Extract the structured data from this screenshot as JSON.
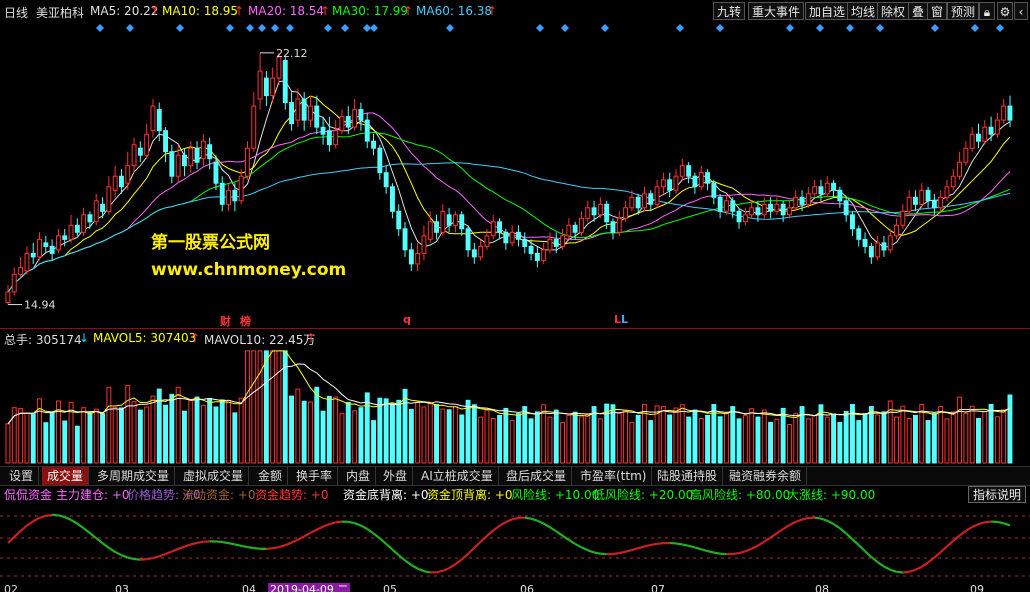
{
  "header": {
    "period": "日线",
    "stock_name": "美亚柏科",
    "ma5": {
      "label": "MA5: 20.22",
      "color": "#e0e0e0",
      "arrow": "up"
    },
    "ma10": {
      "label": "MA10: 18.95",
      "color": "#ffff00",
      "arrow": "up"
    },
    "ma20": {
      "label": "MA20: 18.54",
      "color": "#ff66ff",
      "arrow": "up"
    },
    "ma30": {
      "label": "MA30: 17.99",
      "color": "#00ff00",
      "arrow": "up"
    },
    "ma60": {
      "label": "MA60: 16.38",
      "color": "#44ccff",
      "arrow": "up"
    }
  },
  "toolbar": [
    "九转",
    "重大事件",
    "加自选",
    "均线",
    "除权",
    "叠",
    "窗",
    "预测"
  ],
  "price_chart": {
    "high_label": "22.12",
    "low_label": "14.94",
    "candles": [
      [
        15.0,
        15.3,
        14.94,
        15.5
      ],
      [
        15.3,
        15.8,
        15.2,
        16.0
      ],
      [
        15.8,
        16.0,
        15.7,
        16.3
      ],
      [
        15.9,
        16.4,
        15.8,
        16.6
      ],
      [
        16.4,
        16.3,
        16.1,
        16.7
      ],
      [
        16.3,
        16.8,
        16.2,
        17.0
      ],
      [
        16.7,
        16.6,
        16.4,
        16.9
      ],
      [
        16.6,
        16.4,
        16.2,
        16.8
      ],
      [
        16.5,
        16.9,
        16.4,
        17.1
      ],
      [
        16.9,
        16.8,
        16.6,
        17.1
      ],
      [
        16.8,
        17.2,
        16.7,
        17.5
      ],
      [
        17.2,
        17.0,
        16.9,
        17.4
      ],
      [
        17.0,
        17.5,
        16.9,
        17.7
      ],
      [
        17.5,
        17.3,
        17.1,
        17.6
      ],
      [
        17.3,
        17.9,
        17.2,
        18.1
      ],
      [
        17.8,
        17.6,
        17.4,
        18.0
      ],
      [
        17.6,
        18.3,
        17.5,
        18.6
      ],
      [
        18.2,
        18.6,
        18.0,
        18.9
      ],
      [
        18.6,
        18.3,
        18.1,
        18.8
      ],
      [
        18.4,
        18.9,
        18.2,
        19.3
      ],
      [
        18.9,
        19.5,
        18.7,
        19.7
      ],
      [
        19.4,
        19.2,
        19.0,
        19.6
      ],
      [
        19.2,
        19.8,
        19.1,
        20.1
      ],
      [
        19.9,
        20.6,
        19.7,
        20.8
      ],
      [
        20.5,
        19.9,
        19.6,
        20.7
      ],
      [
        19.9,
        19.3,
        19.0,
        20.0
      ],
      [
        19.3,
        18.6,
        18.4,
        19.5
      ],
      [
        18.6,
        19.2,
        18.4,
        19.5
      ],
      [
        19.2,
        18.9,
        18.6,
        19.4
      ],
      [
        18.9,
        19.4,
        18.7,
        19.6
      ],
      [
        19.4,
        19.0,
        18.8,
        19.6
      ],
      [
        19.1,
        19.6,
        18.9,
        19.8
      ],
      [
        19.5,
        19.1,
        18.8,
        19.7
      ],
      [
        19.0,
        18.4,
        18.2,
        19.2
      ],
      [
        18.4,
        17.8,
        17.6,
        18.6
      ],
      [
        17.8,
        18.2,
        17.6,
        18.4
      ],
      [
        18.2,
        17.9,
        17.6,
        18.4
      ],
      [
        17.9,
        18.6,
        17.8,
        18.8
      ],
      [
        18.6,
        19.4,
        18.5,
        19.6
      ],
      [
        19.4,
        20.6,
        19.3,
        21.0
      ],
      [
        20.8,
        21.6,
        20.5,
        22.12
      ],
      [
        21.4,
        20.9,
        20.6,
        21.6
      ],
      [
        20.9,
        21.4,
        20.7,
        21.7
      ],
      [
        21.4,
        22.0,
        21.2,
        22.12
      ],
      [
        21.9,
        20.7,
        20.5,
        22.0
      ],
      [
        20.7,
        20.1,
        19.9,
        21.0
      ],
      [
        20.2,
        20.8,
        20.0,
        21.1
      ],
      [
        20.8,
        20.2,
        19.9,
        21.0
      ],
      [
        20.2,
        20.6,
        20.0,
        20.9
      ],
      [
        20.6,
        20.0,
        19.8,
        20.9
      ],
      [
        20.0,
        19.8,
        19.5,
        20.3
      ],
      [
        19.9,
        19.5,
        19.3,
        20.3
      ],
      [
        19.5,
        19.9,
        19.4,
        20.2
      ],
      [
        19.9,
        20.3,
        19.8,
        20.5
      ],
      [
        20.3,
        20.0,
        19.8,
        20.6
      ],
      [
        20.0,
        20.5,
        19.9,
        20.8
      ],
      [
        20.5,
        20.2,
        19.9,
        20.7
      ],
      [
        20.2,
        19.6,
        19.4,
        20.4
      ],
      [
        19.6,
        19.4,
        19.2,
        19.8
      ],
      [
        19.4,
        18.7,
        18.5,
        19.5
      ],
      [
        18.7,
        18.3,
        18.1,
        18.9
      ],
      [
        18.3,
        17.6,
        17.4,
        18.4
      ],
      [
        17.6,
        17.1,
        16.9,
        17.8
      ],
      [
        17.1,
        16.5,
        16.3,
        17.3
      ],
      [
        16.5,
        16.1,
        15.9,
        16.7
      ],
      [
        16.1,
        16.4,
        15.9,
        16.7
      ],
      [
        16.4,
        16.9,
        16.2,
        17.2
      ],
      [
        16.8,
        17.3,
        16.7,
        17.6
      ],
      [
        17.3,
        17.0,
        16.8,
        17.5
      ],
      [
        17.0,
        17.6,
        16.9,
        17.8
      ],
      [
        17.5,
        17.2,
        17.0,
        17.7
      ],
      [
        17.2,
        17.5,
        17.0,
        17.6
      ],
      [
        17.5,
        17.1,
        16.9,
        17.6
      ],
      [
        17.1,
        16.5,
        16.3,
        17.2
      ],
      [
        16.5,
        16.3,
        16.1,
        16.7
      ],
      [
        16.3,
        16.6,
        16.2,
        16.8
      ],
      [
        16.6,
        16.9,
        16.5,
        17.1
      ],
      [
        16.9,
        17.3,
        16.8,
        17.5
      ],
      [
        17.3,
        17.0,
        16.8,
        17.4
      ],
      [
        17.0,
        16.7,
        16.5,
        17.1
      ],
      [
        16.7,
        17.0,
        16.6,
        17.2
      ],
      [
        17.0,
        16.8,
        16.6,
        17.2
      ],
      [
        16.8,
        16.6,
        16.4,
        17.0
      ],
      [
        16.6,
        16.4,
        16.2,
        16.8
      ],
      [
        16.4,
        16.2,
        16.0,
        16.6
      ],
      [
        16.2,
        16.5,
        16.1,
        16.7
      ],
      [
        16.5,
        16.8,
        16.4,
        17.0
      ],
      [
        16.8,
        16.6,
        16.4,
        17.0
      ],
      [
        16.6,
        16.9,
        16.5,
        17.1
      ],
      [
        16.9,
        17.2,
        16.8,
        17.4
      ],
      [
        17.2,
        17.0,
        16.8,
        17.3
      ],
      [
        17.0,
        17.4,
        16.9,
        17.6
      ],
      [
        17.4,
        17.7,
        17.3,
        17.9
      ],
      [
        17.7,
        17.5,
        17.3,
        17.9
      ],
      [
        17.5,
        17.8,
        17.4,
        18.0
      ],
      [
        17.8,
        17.3,
        17.1,
        17.9
      ],
      [
        17.3,
        17.0,
        16.8,
        17.4
      ],
      [
        17.0,
        17.4,
        16.9,
        17.6
      ],
      [
        17.4,
        17.7,
        17.3,
        17.9
      ],
      [
        17.7,
        18.0,
        17.6,
        18.2
      ],
      [
        18.0,
        17.7,
        17.5,
        18.1
      ],
      [
        17.7,
        18.1,
        17.6,
        18.3
      ],
      [
        18.1,
        17.8,
        17.6,
        18.2
      ],
      [
        17.8,
        18.3,
        17.7,
        18.5
      ],
      [
        18.3,
        18.5,
        18.1,
        18.7
      ],
      [
        18.5,
        18.2,
        18.0,
        18.7
      ],
      [
        18.2,
        18.6,
        18.1,
        18.8
      ],
      [
        18.6,
        18.9,
        18.5,
        19.1
      ],
      [
        18.9,
        18.6,
        18.4,
        19.0
      ],
      [
        18.6,
        18.3,
        18.1,
        18.7
      ],
      [
        18.3,
        18.7,
        18.2,
        18.9
      ],
      [
        18.7,
        18.4,
        18.2,
        18.8
      ],
      [
        18.4,
        18.0,
        17.8,
        18.5
      ],
      [
        18.0,
        17.6,
        17.4,
        18.1
      ],
      [
        17.6,
        17.9,
        17.5,
        18.1
      ],
      [
        17.9,
        17.6,
        17.4,
        18.0
      ],
      [
        17.6,
        17.3,
        17.1,
        17.7
      ],
      [
        17.3,
        17.5,
        17.2,
        17.7
      ],
      [
        17.5,
        17.7,
        17.4,
        17.9
      ],
      [
        17.7,
        17.5,
        17.3,
        17.9
      ],
      [
        17.5,
        17.8,
        17.4,
        18.0
      ],
      [
        17.8,
        17.6,
        17.4,
        18.0
      ],
      [
        17.6,
        17.8,
        17.5,
        18.0
      ],
      [
        17.8,
        17.5,
        17.3,
        17.9
      ],
      [
        17.5,
        17.7,
        17.4,
        17.9
      ],
      [
        17.7,
        18.0,
        17.6,
        18.2
      ],
      [
        18.0,
        17.8,
        17.6,
        18.2
      ],
      [
        17.8,
        18.1,
        17.7,
        18.3
      ],
      [
        18.1,
        18.3,
        18.0,
        18.5
      ],
      [
        18.3,
        18.1,
        17.9,
        18.5
      ],
      [
        18.1,
        18.4,
        18.0,
        18.6
      ],
      [
        18.4,
        18.2,
        18.0,
        18.5
      ],
      [
        18.2,
        17.9,
        17.7,
        18.3
      ],
      [
        17.9,
        17.5,
        17.3,
        18.0
      ],
      [
        17.5,
        17.1,
        16.9,
        17.6
      ],
      [
        17.1,
        16.8,
        16.6,
        17.2
      ],
      [
        16.8,
        16.6,
        16.4,
        17.0
      ],
      [
        16.6,
        16.3,
        16.1,
        16.7
      ],
      [
        16.3,
        16.7,
        16.2,
        16.9
      ],
      [
        16.7,
        16.5,
        16.3,
        16.9
      ],
      [
        16.5,
        16.9,
        16.4,
        17.1
      ],
      [
        16.9,
        17.2,
        16.8,
        17.4
      ],
      [
        17.2,
        17.6,
        17.1,
        17.8
      ],
      [
        17.6,
        18.0,
        17.5,
        18.2
      ],
      [
        18.0,
        17.8,
        17.6,
        18.2
      ],
      [
        17.8,
        18.2,
        17.7,
        18.4
      ],
      [
        18.2,
        17.9,
        17.7,
        18.3
      ],
      [
        17.9,
        17.7,
        17.5,
        18.1
      ],
      [
        17.7,
        18.0,
        17.6,
        18.2
      ],
      [
        18.0,
        18.3,
        17.9,
        18.5
      ],
      [
        18.3,
        18.6,
        18.2,
        18.8
      ],
      [
        18.6,
        19.0,
        18.5,
        19.3
      ],
      [
        19.0,
        19.4,
        18.9,
        19.6
      ],
      [
        19.4,
        19.8,
        19.3,
        20.0
      ],
      [
        19.8,
        19.6,
        19.4,
        20.1
      ],
      [
        19.6,
        20.0,
        19.5,
        20.2
      ],
      [
        20.0,
        19.8,
        19.6,
        20.3
      ],
      [
        19.8,
        20.2,
        19.7,
        20.4
      ],
      [
        20.2,
        20.6,
        20.1,
        20.8
      ],
      [
        20.6,
        20.2,
        20.0,
        20.9
      ]
    ]
  },
  "events": [
    {
      "label": "财",
      "color": "#ff3333"
    },
    {
      "label": "榜",
      "color": "#ff3333"
    },
    {
      "label": "q",
      "color": "#ff3333"
    },
    {
      "label": "L",
      "color": "#ff3333"
    },
    {
      "label": "L",
      "color": "#44aaff"
    }
  ],
  "volume_header": {
    "total": "总手: 305174",
    "mavol5": "MAVOL5: 307403",
    "mavol10": "MAVOL10: 22.45万"
  },
  "tabs": [
    "设置",
    "成交量",
    "多周期成交量",
    "虚拟成交量",
    "金额",
    "换手率",
    "内盘",
    "外盘",
    "AI立桩成交量",
    "盘后成交量",
    "市盈率(ttm)",
    "陆股通持股",
    "融资融券余额"
  ],
  "indicator_header": [
    {
      "text": "侃侃资金",
      "color": "#ff66ff"
    },
    {
      "text": "主力建仓: +0",
      "color": "#ff66ff"
    },
    {
      "text": "价格趋势: +0",
      "color": "#9b59d0"
    },
    {
      "text": "流动资金: +0",
      "color": "#a06030"
    },
    {
      "text": "资金趋势: +0",
      "color": "#ff3030"
    },
    {
      "text": "资金底背离: +0",
      "color": "#ffffff"
    },
    {
      "text": "资金顶背离: +0",
      "color": "#ffff00"
    },
    {
      "text": "风险线: +10.00",
      "color": "#00ff00"
    },
    {
      "text": "低风险线: +20.00",
      "color": "#00ff00"
    },
    {
      "text": "高风险线: +80.00",
      "color": "#00ff00"
    },
    {
      "text": "大涨线: +90.00",
      "color": "#00ff00"
    }
  ],
  "indicator_button": "指标说明",
  "watermark": {
    "title": "第一股票公式网",
    "url": "www.chnmoney.com"
  },
  "x_axis": [
    "02",
    "03",
    "04",
    "2019-04-09 二",
    "05",
    "06",
    "07",
    "08",
    "09"
  ]
}
